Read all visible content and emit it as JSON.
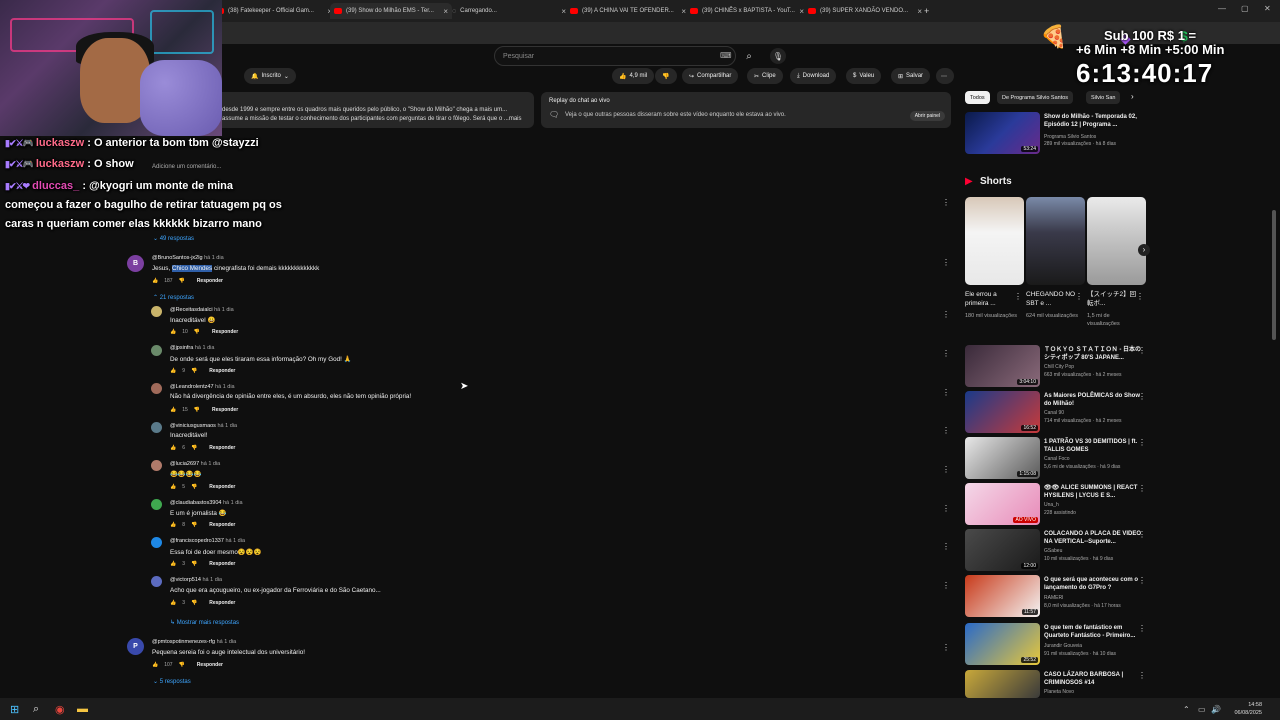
{
  "browser": {
    "tabs": [
      {
        "label": "(38) Fatekeeper - Official Gam..."
      },
      {
        "label": "(39) Show do Milhão EMS - Ter..."
      },
      {
        "label": "Carregando..."
      },
      {
        "label": "(39) A CHINA VAI TE OFENDER..."
      },
      {
        "label": "(39) CHINÊS x BAPTISTA - YouT..."
      },
      {
        "label": "(39) SUPER XANDÃO VENDO..."
      }
    ],
    "new_tab": "+"
  },
  "search": {
    "placeholder": "Pesquisar"
  },
  "overlay": {
    "line1": "Sub    100    R$ 1 =",
    "line2": "+6 Min  +8 Min  +5:00 Min",
    "timer": "6:13:40:17"
  },
  "video_actions": {
    "subscribed": "Inscrito",
    "likes": "4,9 mil",
    "share": "Compartilhar",
    "clip": "Clipe",
    "download": "Download",
    "thanks": "Valeu",
    "save": "Salvar"
  },
  "description": {
    "text": "desde 1999 e sempre entre os quadros mais queridos pelo público, o \"Show do Milhão\" chega a mais um... assume a missão de testar o conhecimento dos participantes com perguntas de tirar o fôlego. Será que o ...mais"
  },
  "replay": {
    "title": "Replay do chat ao vivo",
    "subtitle": "Veja o que outras pessoas disseram sobre este vídeo enquanto ele estava ao vivo.",
    "button": "Abrir painel"
  },
  "chat_overlay": [
    {
      "user": "luckaszw",
      "text": ": O anterior ta bom tbm @stayzzi"
    },
    {
      "user": "luckaszw",
      "text": ": O show"
    },
    {
      "user": "dluccas_",
      "text": ": @kyogri um monte de mina"
    },
    {
      "user": "",
      "text": "começou a fazer o bagulho de retirar tatuagem pq os"
    },
    {
      "user": "",
      "text": "caras n queriam comer elas kkkkkk bizarro mano"
    }
  ],
  "add_comment_hint": "Adicione um comentário...",
  "comments": {
    "thread1_replies": "49 respostas",
    "main": {
      "avatar": "B",
      "handle": "@BrunoSantos-jx2lg",
      "time": "há 1 dia",
      "text_before": "Jesus, ",
      "text_highlight": "Chico Mendes",
      "text_after": " cinegrafista foi demais kkkkkkkkkkkkk",
      "likes": "187",
      "reply": "Responder",
      "replies_toggle": "21 respostas"
    },
    "replies": [
      {
        "handle": "@Receitasdaialci",
        "time": "há 1 dia",
        "text": "Inacreditável 😀",
        "likes": "10",
        "avatar_color": "#c9b46a"
      },
      {
        "handle": "@jpsinfra",
        "time": "há 1 dia",
        "text": "De onde será que eles tiraram essa informação? Oh my God! 🙏",
        "likes": "9",
        "avatar_color": "#6a8a6a"
      },
      {
        "handle": "@Leandrolentz47",
        "time": "há 1 dia",
        "text": "Não há divergência de opinião entre eles, é um absurdo, eles não tem opinião própria!",
        "likes": "15",
        "avatar_color": "#a06a5a"
      },
      {
        "handle": "@viniciusgusmaos",
        "time": "há 1 dia",
        "text": "Inacreditável!",
        "likes": "6",
        "avatar_color": "#5a7a8a"
      },
      {
        "handle": "@lucia2697",
        "time": "há 1 dia",
        "text": "😂😂😂😂",
        "likes": "5",
        "avatar_color": "#b07a6a"
      },
      {
        "handle": "@claudiabastos3904",
        "time": "há 1 dia",
        "text": "E um é jornalista 😂",
        "likes": "8",
        "avatar_color": "#3fa84f"
      },
      {
        "handle": "@franciscopedro1337",
        "time": "há 1 dia",
        "text": "Essa foi de doer mesmo😵😵😵",
        "likes": "3",
        "avatar_color": "#1e88e5"
      },
      {
        "handle": "@victorp514",
        "time": "há 1 dia",
        "text": "Acho que era açougueiro, ou ex-jogador da Ferroviária e do São Caetano...",
        "likes": "3",
        "avatar_color": "#5c6bc0"
      }
    ],
    "more_replies": "Mostrar mais respostas",
    "main2": {
      "avatar": "P",
      "handle": "@pmtospotinmenezes-rfg",
      "time": "há 1 dia",
      "text": "Pequena sereia foi o auge intelectual dos universitário!",
      "likes": "107",
      "reply": "Responder",
      "replies_toggle": "5 respostas"
    }
  },
  "sidebar": {
    "chips": [
      "Todos",
      "De Programa Silvio Santos",
      "Silvio San"
    ],
    "top_video": {
      "title": "Show do Milhão - Temporada 02, Episódio 12 | Programa ...",
      "channel": "Programa Silvio Santos",
      "meta": "289 mil visualizações · há 8 dias",
      "duration": "53:24"
    },
    "shorts_title": "Shorts",
    "shorts": [
      {
        "title": "Ele errou a primeira ...",
        "views": "180 mil visualizações"
      },
      {
        "title": "CHEGANDO NO SBT e ...",
        "views": "624 mil visualizações"
      },
      {
        "title": "【スイッチ2】回転ボ...",
        "views": "1,5 mi de visualizações"
      }
    ],
    "videos": [
      {
        "title": "ＴＯＫＹＯ ＳＴＡＴＩＯＮ - 日本のシティポップ 80'S JAPANE...",
        "channel": "Chill City Pop",
        "meta": "663 mil visualizações · há 2 meses",
        "duration": "3:04:10"
      },
      {
        "title": "As Maiores POLÊMICAS do Show do Milhão!",
        "channel": "Canal 90",
        "meta": "714 mil visualizações · há 2 meses",
        "duration": "16:52"
      },
      {
        "title": "1 PATRÃO VS 30 DEMITIDOS | ft. TALLIS GOMES",
        "channel": "Canal Foco",
        "meta": "5,6 mi de visualizações · há 9 dias",
        "duration": "1:15:08"
      },
      {
        "title": "👁👁 ALICE SUMMONS | REACT HYSILENS | LYCUS E S...",
        "channel": "Una_h",
        "meta": "228 assistindo",
        "duration": "AO VIVO"
      },
      {
        "title": "COLACANDO A PLACA DE VIDEO NA VERTICAL--Suporte...",
        "channel": "GSabeu",
        "meta": "10 mil visualizações · há 9 dias",
        "duration": "12:00"
      },
      {
        "title": "O que será que aconteceu com o lançamento do G7Pro ?",
        "channel": "RAMERI",
        "meta": "8,0 mil visualizações · há 17 horas",
        "duration": "11:57"
      },
      {
        "title": "O que tem de fantástico em Quarteto Fantástico - Primeiro...",
        "channel": "Jurandir Gouveia",
        "meta": "91 mil visualizações · há 10 dias",
        "duration": "25:52"
      },
      {
        "title": "CASO LÁZARO BARBOSA | CRIMINOSOS #14",
        "channel": "Planeta Novo",
        "meta": "",
        "duration": ""
      }
    ]
  },
  "taskbar": {
    "time": "14:58",
    "date": "06/08/2025"
  }
}
